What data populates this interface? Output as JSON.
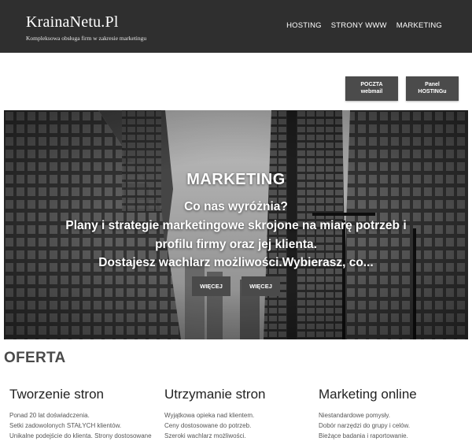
{
  "header": {
    "brand": "KrainaNetu.Pl",
    "tagline": "Kompleksowa obsługa firm w zakresie marketingu",
    "nav": [
      "HOSTING",
      "STRONY WWW",
      "MARKETING"
    ]
  },
  "quick_buttons": {
    "poczta": {
      "line1": "POCZTA",
      "line2": "webmail"
    },
    "panel": {
      "line1": "Panel",
      "line2": "HOSTINGu"
    }
  },
  "hero": {
    "title": "MARKETING",
    "lines": [
      "Co nas wyróżnia?",
      "Plany i strategie marketingowe skrojone na miarę potrzeb i",
      "profilu firmy oraz jej klienta.",
      "Dostajesz wachlarz możliwości.Wybierasz, co..."
    ],
    "buttons": [
      "WIĘCEJ",
      "WIĘCEJ"
    ]
  },
  "offer": {
    "title": "OFERTA",
    "columns": [
      {
        "heading": "Tworzenie stron",
        "lines": [
          "Ponad 20 lat doświadczenia.",
          "Setki zadowolonych STAŁYCH klientów.",
          "Unikalne podejście do klienta. Strony dostosowane"
        ]
      },
      {
        "heading": "Utrzymanie stron",
        "lines": [
          "Wyjątkowa opieka nad klientem.",
          "Ceny dostosowane do potrzeb.",
          "Szeroki wachlarz możliwości."
        ]
      },
      {
        "heading": "Marketing online",
        "lines": [
          "Niestandardowe pomysły.",
          "Dobór narzędzi do grupy i celów.",
          "Bieżące badania i raportowanie."
        ]
      }
    ]
  }
}
